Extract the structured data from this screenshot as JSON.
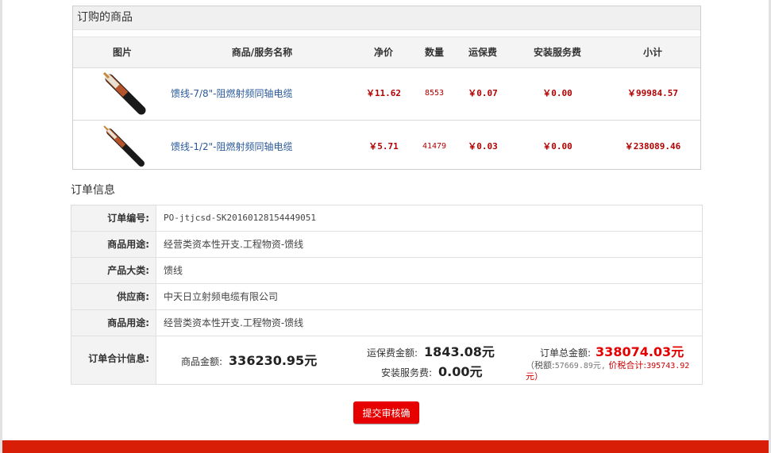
{
  "items": {
    "title": "订购的商品",
    "headers": [
      "图片",
      "商品/服务名称",
      "净价",
      "数量",
      "运保费",
      "安装服务费",
      "小计"
    ],
    "rows": [
      {
        "name": "馈线-7/8\"-阻燃射频同轴电缆",
        "price": "￥11.62",
        "qty": "8553",
        "shipping": "￥0.07",
        "install": "￥0.00",
        "subtotal": "￥99984.57",
        "image_icon": "coaxial-cable-image"
      },
      {
        "name": "馈线-1/2\"-阻燃射频同轴电缆",
        "price": "￥5.71",
        "qty": "41479",
        "shipping": "￥0.03",
        "install": "￥0.00",
        "subtotal": "￥238089.46",
        "image_icon": "coaxial-cable-image"
      }
    ]
  },
  "order_info": {
    "title": "订单信息",
    "rows": [
      {
        "label": "订单编号:",
        "value": "PO-jtjcsd-SK20160128154449051"
      },
      {
        "label": "商品用途:",
        "value": "经营类资本性开支.工程物资-馈线"
      },
      {
        "label": "产品大类:",
        "value": "馈线"
      },
      {
        "label": "供应商:",
        "value": "中天日立射频电缆有限公司"
      },
      {
        "label": "商品用途:",
        "value": "经营类资本性开支.工程物资-馈线"
      }
    ],
    "total": {
      "label": "订单合计信息:",
      "goods_label": "商品金额:",
      "goods_value": "336230.95元",
      "shipping_label": "运保费金额:",
      "shipping_value": "1843.08元",
      "install_label": "安装服务费:",
      "install_value": "0.00元",
      "order_total_label": "订单总金额:",
      "order_total_value": "338074.03元",
      "tax_prefix": "（税额:",
      "tax_value": "57669.89元,",
      "price_tax_label": "价税合计:",
      "price_tax_value": "395743.92",
      "tax_suffix": "元）"
    }
  },
  "submit_label": "提交审核确认",
  "colors": {
    "accent": "#e60000",
    "price_red": "#b30000",
    "link_blue": "#2a5a9a"
  }
}
